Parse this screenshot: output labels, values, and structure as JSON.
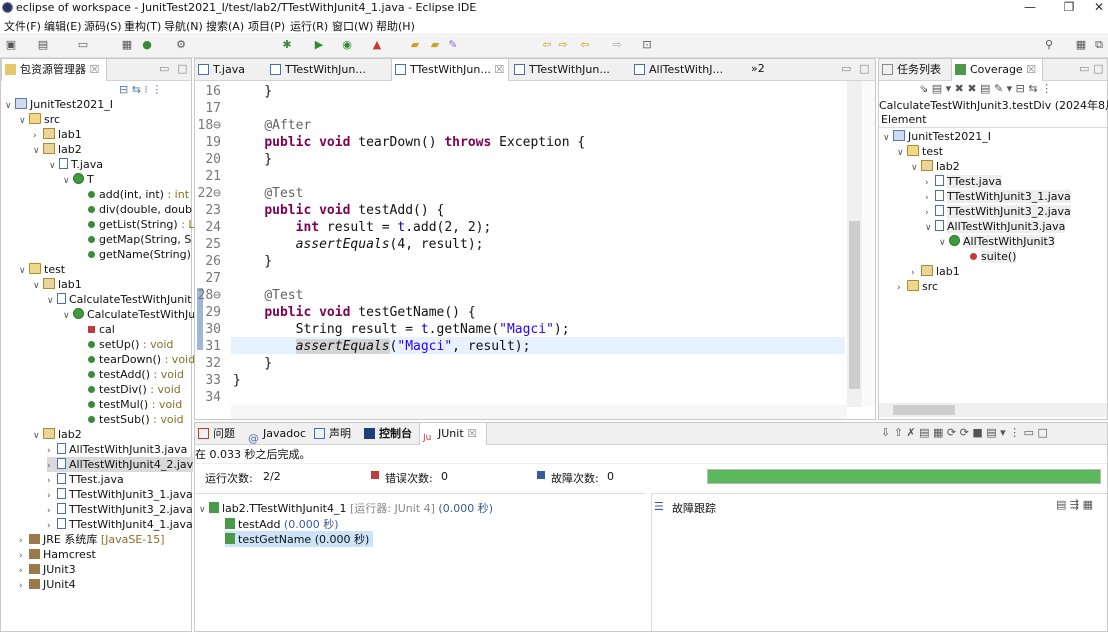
{
  "window": {
    "title": "eclipse of workspace - JunitTest2021_I/test/lab2/TTestWithJunit4_1.java - Eclipse IDE"
  },
  "menu": [
    "文件(F)",
    "编辑(E)",
    "源码(S)",
    "重构(T)",
    "导航(N)",
    "搜索(A)",
    "项目(P)",
    "运行(R)",
    "窗口(W)",
    "帮助(H)"
  ],
  "package_explorer": {
    "tab_label": "包资源管理器",
    "tree": [
      {
        "label": "JunitTest2021_I"
      },
      {
        "label": "src"
      },
      {
        "label": "lab1"
      },
      {
        "label": "lab2"
      },
      {
        "label": "T.java"
      },
      {
        "label": "T"
      },
      {
        "label": "add(int, int)",
        "suffix": " : int"
      },
      {
        "label": "div(double, doub"
      },
      {
        "label": "getList(String)",
        "suffix": " : L"
      },
      {
        "label": "getMap(String, S"
      },
      {
        "label": "getName(String)"
      },
      {
        "label": "test"
      },
      {
        "label": "lab1"
      },
      {
        "label": "CalculateTestWithJunit"
      },
      {
        "label": "CalculateTestWithJu"
      },
      {
        "label": "cal"
      },
      {
        "label": "setUp()",
        "suffix": " : void"
      },
      {
        "label": "tearDown()",
        "suffix": " : void"
      },
      {
        "label": "testAdd()",
        "suffix": " : void"
      },
      {
        "label": "testDiv()",
        "suffix": " : void"
      },
      {
        "label": "testMul()",
        "suffix": " : void"
      },
      {
        "label": "testSub()",
        "suffix": " : void"
      },
      {
        "label": "lab2"
      },
      {
        "label": "AllTestWithJunit3.java"
      },
      {
        "label": "AllTestWithJunit4_2.jav"
      },
      {
        "label": "TTest.java"
      },
      {
        "label": "TTestWithJunit3_1.java"
      },
      {
        "label": "TTestWithJunit3_2.java"
      },
      {
        "label": "TTestWithJunit4_1.java"
      },
      {
        "label": "JRE 系统库",
        "suffix": " [JavaSE-15]"
      },
      {
        "label": "Hamcrest"
      },
      {
        "label": "JUnit3"
      },
      {
        "label": "JUnit4"
      }
    ]
  },
  "editor": {
    "tabs": [
      "T.java",
      "TTestWithJun...",
      "TTestWithJun...",
      "TTestWithJun...",
      "AllTestWithJ..."
    ],
    "overflow": "»2",
    "lines": [
      {
        "n": "16",
        "text": "    }"
      },
      {
        "n": "17",
        "text": ""
      },
      {
        "n": "18⊖",
        "text": "    @After"
      },
      {
        "n": "19",
        "text": "    public void tearDown() throws Exception {"
      },
      {
        "n": "20",
        "text": "    }"
      },
      {
        "n": "21",
        "text": ""
      },
      {
        "n": "22⊖",
        "text": "    @Test"
      },
      {
        "n": "23",
        "text": "    public void testAdd() {"
      },
      {
        "n": "24",
        "text": "        int result = t.add(2, 2);"
      },
      {
        "n": "25",
        "text": "        assertEquals(4, result);"
      },
      {
        "n": "26",
        "text": "    }"
      },
      {
        "n": "27",
        "text": ""
      },
      {
        "n": "28⊖",
        "text": "    @Test"
      },
      {
        "n": "29",
        "text": "    public void testGetName() {"
      },
      {
        "n": "30",
        "text": "        String result = t.getName(\"Magci\");"
      },
      {
        "n": "31",
        "text": "        assertEquals(\"Magci\", result);"
      },
      {
        "n": "32",
        "text": "    }"
      },
      {
        "n": "33",
        "text": "}"
      },
      {
        "n": "34",
        "text": ""
      }
    ]
  },
  "coverage": {
    "tabs": [
      "任务列表",
      "Coverage"
    ],
    "session": "CalculateTestWithJunit3.testDiv (2024年8月2",
    "column": "Element",
    "tree": [
      "JunitTest2021_I",
      "test",
      "lab2",
      "TTest.java",
      "TTestWithJunit3_1.java",
      "TTestWithJunit3_2.java",
      "AllTestWithJunit3.java",
      "AllTestWithJunit3",
      "suite()",
      "lab1",
      "src"
    ]
  },
  "bottom": {
    "tabs": [
      "问题",
      "Javadoc",
      "声明",
      "控制台",
      "JUnit"
    ],
    "finished": "在 0.033 秒之后完成。",
    "runs_label": "运行次数:",
    "runs_value": "2/2",
    "errors_label": "错误次数:",
    "errors_value": "0",
    "failures_label": "故障次数:",
    "failures_value": "0",
    "progress": 1.0,
    "progress_color": "#5cb85c",
    "root": {
      "label": "lab2.TTestWithJunit4_1",
      "runner": "[运行器: JUnit 4]",
      "time": "(0.000 秒)"
    },
    "tests": [
      {
        "label": "testAdd",
        "time": "(0.000 秒)"
      },
      {
        "label": "testGetName",
        "time": "(0.000 秒)"
      }
    ],
    "trace_label": "故障跟踪"
  }
}
